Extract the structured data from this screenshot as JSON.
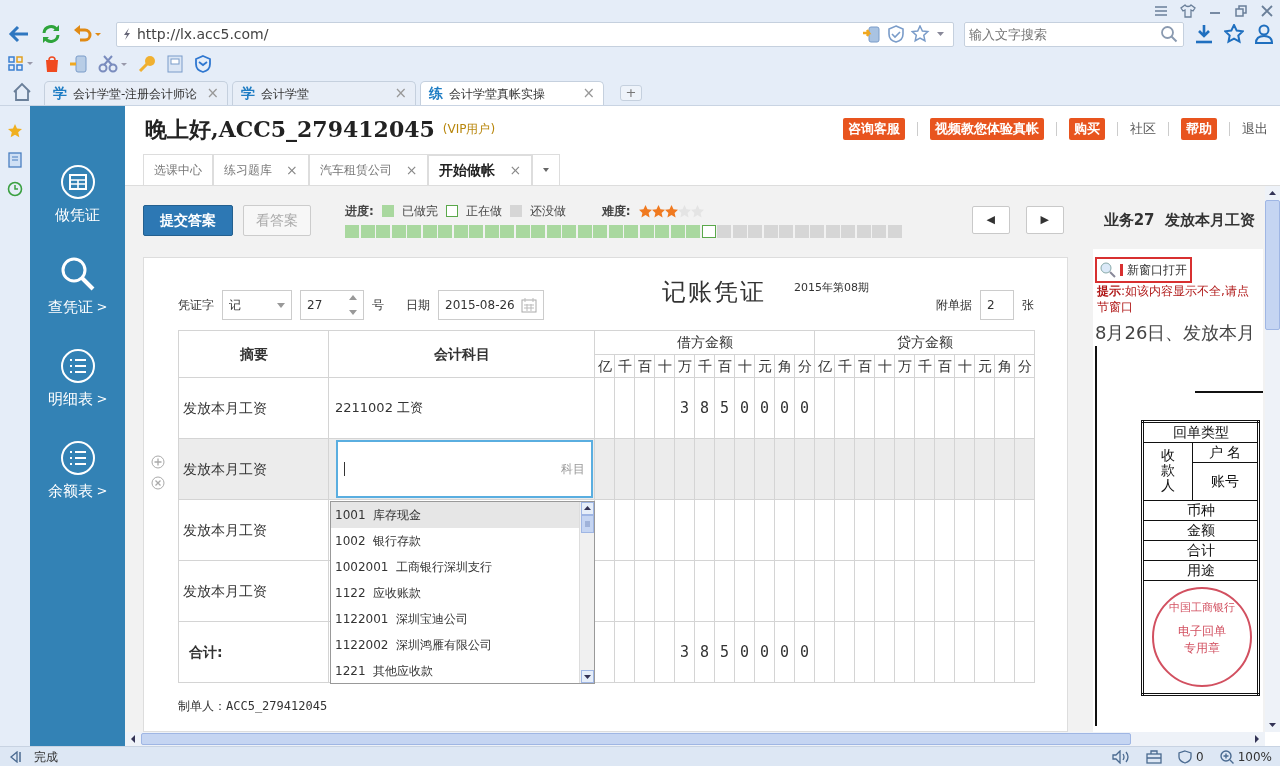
{
  "browser": {
    "url": "http://lx.acc5.com/",
    "search_placeholder": "输入文字搜索",
    "tabs": [
      {
        "icon_text": "学",
        "label": "会计学堂-注册会计师论",
        "close": "×",
        "selected": false
      },
      {
        "icon_text": "学",
        "label": "会计学堂",
        "close": "×",
        "selected": false
      },
      {
        "icon_text": "练",
        "label": "会计学堂真帐实操",
        "close": "×",
        "selected": true
      }
    ],
    "new_tab": "+",
    "status": "完成",
    "ad_count": "0",
    "zoom": "100%"
  },
  "sidebar": {
    "items": [
      {
        "kind": "voucher",
        "label": "做凭证"
      },
      {
        "kind": "search",
        "label": "查凭证",
        "chevron": ">"
      },
      {
        "kind": "list",
        "label": "明细表",
        "chevron": ">"
      },
      {
        "kind": "list",
        "label": "余额表",
        "chevron": ">"
      }
    ]
  },
  "header": {
    "greeting": "晚上好,ACC5_279412045",
    "badge": "(VIP用户)",
    "actions": [
      {
        "kind": "red",
        "label": "咨询客服"
      },
      {
        "kind": "red",
        "label": "视频教您体验真帐"
      },
      {
        "kind": "red",
        "label": "购买"
      },
      {
        "kind": "link",
        "label": "社区"
      },
      {
        "kind": "red",
        "label": "帮助"
      },
      {
        "kind": "link",
        "label": "退出"
      }
    ]
  },
  "page_tabs": [
    {
      "label": "选课中心",
      "selected": false
    },
    {
      "label": "练习题库",
      "close": "×",
      "selected": false
    },
    {
      "label": "汽车租赁公司",
      "close": "×",
      "selected": false
    },
    {
      "label": "开始做帐",
      "close": "×",
      "selected": true
    }
  ],
  "toolbar": {
    "submit": "提交答案",
    "answer": {
      "label": "看答案",
      "disabled": true
    },
    "progress_label": "进度:",
    "legend": [
      {
        "kind": "done",
        "label": "已做完"
      },
      {
        "kind": "current",
        "label": "正在做"
      },
      {
        "kind": "todo",
        "label": "还没做"
      }
    ],
    "difficulty_label": "难度:",
    "stars": 3,
    "steps": [
      {
        "kind": "done"
      },
      {
        "kind": "done"
      },
      {
        "kind": "done"
      },
      {
        "kind": "done"
      },
      {
        "kind": "done"
      },
      {
        "kind": "done"
      },
      {
        "kind": "done"
      },
      {
        "kind": "done"
      },
      {
        "kind": "done"
      },
      {
        "kind": "done"
      },
      {
        "kind": "done"
      },
      {
        "kind": "done"
      },
      {
        "kind": "done"
      },
      {
        "kind": "done"
      },
      {
        "kind": "done"
      },
      {
        "kind": "done"
      },
      {
        "kind": "done"
      },
      {
        "kind": "done"
      },
      {
        "kind": "done"
      },
      {
        "kind": "done"
      },
      {
        "kind": "done"
      },
      {
        "kind": "done"
      },
      {
        "kind": "done"
      },
      {
        "kind": "current"
      },
      {
        "kind": "todo"
      },
      {
        "kind": "todo"
      },
      {
        "kind": "todo"
      },
      {
        "kind": "todo"
      },
      {
        "kind": "todo"
      },
      {
        "kind": "todo"
      },
      {
        "kind": "todo"
      },
      {
        "kind": "todo"
      },
      {
        "kind": "todo"
      },
      {
        "kind": "todo"
      },
      {
        "kind": "todo"
      },
      {
        "kind": "todo"
      }
    ],
    "prev": "◀",
    "next": "▶",
    "task_title": "业务27  发放本月工资"
  },
  "voucher": {
    "type_label": "凭证字",
    "type": "记",
    "number": "27",
    "number_suffix": "号",
    "date_label": "日期",
    "date": "2015-08-26",
    "title": "记账凭证",
    "period": "2015年第08期",
    "attach_label": "附单据",
    "attachments": "2",
    "attach_suffix": "张",
    "columns": [
      "摘要",
      "会计科目",
      "借方金额",
      "贷方金额"
    ],
    "debit_units": [
      "亿",
      "千",
      "百",
      "十",
      "万",
      "千",
      "百",
      "十",
      "元",
      "角",
      "分"
    ],
    "credit_units": [
      "亿",
      "千",
      "百",
      "十",
      "万",
      "千",
      "百",
      "十",
      "元",
      "角",
      "分"
    ],
    "rows": [
      {
        "summary": "发放本月工资",
        "account": "2211002 工资",
        "debit": [
          "3",
          "8",
          "5",
          "0",
          "0",
          "0",
          "0"
        ],
        "active": false
      },
      {
        "summary": "发放本月工资",
        "account_hint": "科目",
        "active": true
      },
      {
        "summary": "发放本月工资",
        "active": false
      },
      {
        "summary": "发放本月工资",
        "active": false
      }
    ],
    "total": {
      "label": "合计:",
      "debit": [
        "3",
        "8",
        "5",
        "0",
        "0",
        "0",
        "0"
      ]
    },
    "dropdown": [
      {
        "label": "1001  库存现金",
        "selected": true
      },
      {
        "label": "1002  银行存款",
        "selected": false
      },
      {
        "label": "1002001  工商银行深圳支行",
        "selected": false
      },
      {
        "label": "1122  应收账款",
        "selected": false
      },
      {
        "label": "1122001  深圳宝迪公司",
        "selected": false
      },
      {
        "label": "1122002  深圳鸿雁有限公司",
        "selected": false
      },
      {
        "label": "1221  其他应收款",
        "selected": false
      }
    ],
    "preparer": "制单人：ACC5_279412045"
  },
  "side_panel": {
    "open_button": "新窗口打开",
    "hint_lines": [
      "**提示**:如该内容显示不全,请点",
      "节窗口"
    ],
    "title": "8月26日、发放本月",
    "receipt": {
      "type": "回单类型",
      "payee": "收款人",
      "name": "户 名",
      "account": "账号",
      "rows": [
        "币种",
        "金额",
        "合计",
        "用途"
      ],
      "seal": [
        "中国工商银行",
        "电子回单",
        "专用章"
      ]
    }
  }
}
